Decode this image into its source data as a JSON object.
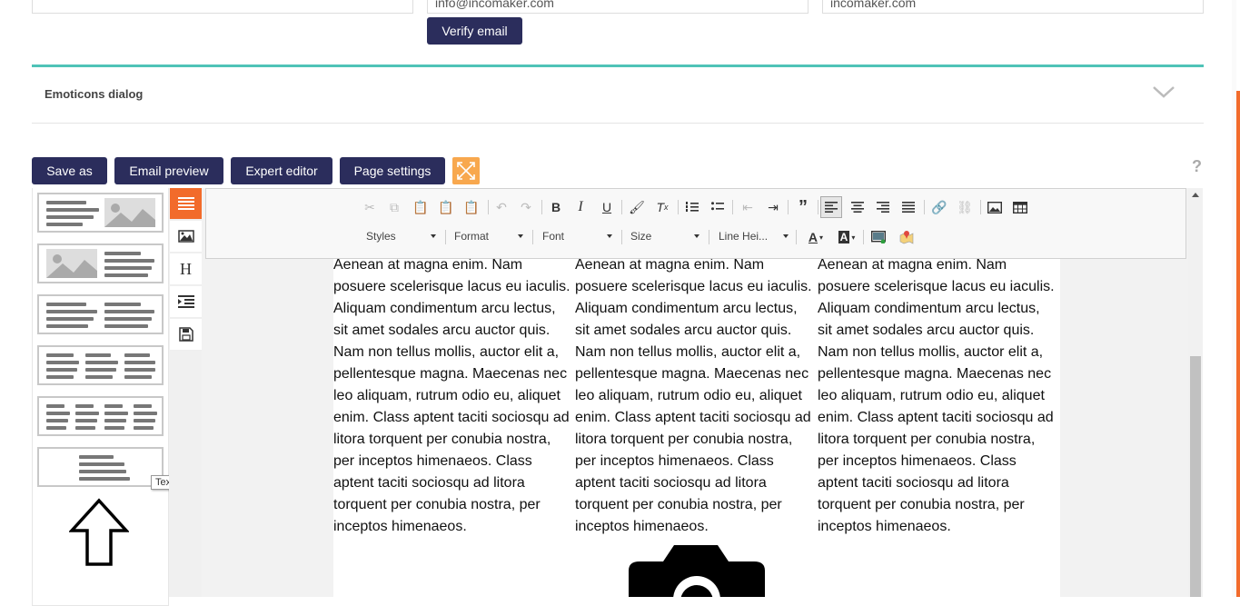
{
  "top": {
    "email_value": "info@incomaker.com",
    "domain_value": "incomaker.com",
    "verify_label": "Verify email"
  },
  "accordion": {
    "title": "Emoticons dialog"
  },
  "actions": {
    "save_as": "Save as",
    "email_preview": "Email preview",
    "expert_editor": "Expert editor",
    "page_settings": "Page settings",
    "help": "?"
  },
  "toolbar": {
    "styles": "Styles",
    "format": "Format",
    "font": "Font",
    "size": "Size",
    "line_height": "Line Hei..."
  },
  "tooltip": "Text",
  "content": {
    "columns": [
      "Aenean at magna enim. Nam posuere scelerisque lacus eu iaculis. Aliquam condimentum arcu lectus, sit amet sodales arcu auctor quis. Nam non tellus mollis, auctor elit a, pellentesque magna. Maecenas nec leo aliquam, rutrum odio eu, aliquet enim. Class aptent taciti sociosqu ad litora torquent per conubia nostra, per inceptos himenaeos. Class aptent taciti sociosqu ad litora torquent per conubia nostra, per inceptos himenaeos.",
      "Aenean at magna enim. Nam posuere scelerisque lacus eu iaculis. Aliquam condimentum arcu lectus, sit amet sodales arcu auctor quis. Nam non tellus mollis, auctor elit a, pellentesque magna. Maecenas nec leo aliquam, rutrum odio eu, aliquet enim. Class aptent taciti sociosqu ad litora torquent per conubia nostra, per inceptos himenaeos. Class aptent taciti sociosqu ad litora torquent per conubia nostra, per inceptos himenaeos.",
      "Aenean at magna enim. Nam posuere scelerisque lacus eu iaculis. Aliquam condimentum arcu lectus, sit amet sodales arcu auctor quis. Nam non tellus mollis, auctor elit a, pellentesque magna. Maecenas nec leo aliquam, rutrum odio eu, aliquet enim. Class aptent taciti sociosqu ad litora torquent per conubia nostra, per inceptos himenaeos. Class aptent taciti sociosqu ad litora torquent per conubia nostra, per inceptos himenaeos."
    ]
  },
  "colors": {
    "accent_dark": "#2b2d5c",
    "teal": "#4fc3b7",
    "orange": "#f26b2b",
    "expand": "#f8a84e"
  },
  "icons": {
    "left_tools": [
      "layout-icon",
      "image-icon",
      "heading-icon",
      "indent-icon",
      "save-icon"
    ],
    "toolbar_row1": [
      "cut-icon",
      "copy-icon",
      "paste-icon",
      "paste-text-icon",
      "paste-word-icon",
      "undo-icon",
      "redo-icon",
      "bold-icon",
      "italic-icon",
      "underline-icon",
      "copy-format-icon",
      "remove-format-icon",
      "numbered-list-icon",
      "bulleted-list-icon",
      "outdent-icon",
      "indent-icon",
      "blockquote-icon",
      "align-left-icon",
      "align-center-icon",
      "align-right-icon",
      "justify-icon",
      "link-icon",
      "unlink-icon",
      "image-icon",
      "table-icon"
    ]
  }
}
